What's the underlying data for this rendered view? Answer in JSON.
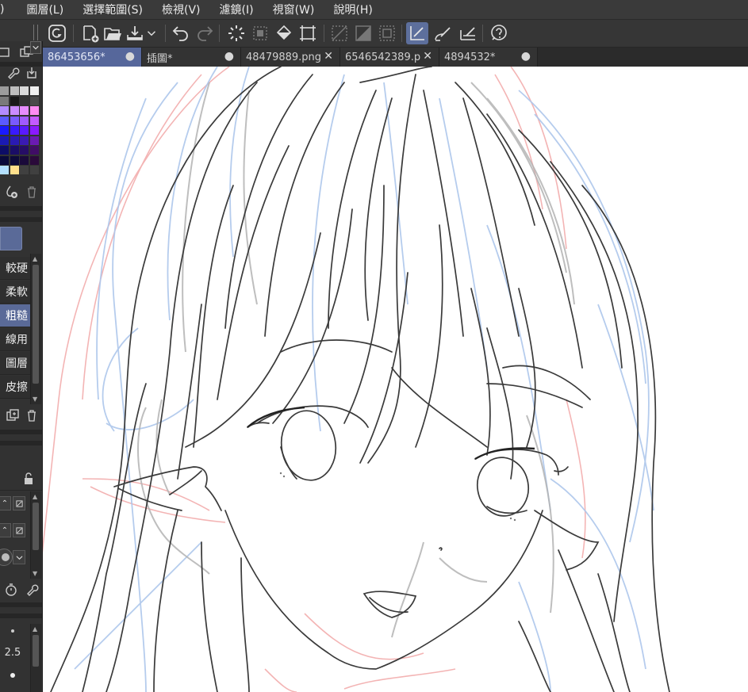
{
  "menu": {
    "items": [
      ")",
      "圖層(L)",
      "選擇範圍(S)",
      "檢視(V)",
      "濾鏡(I)",
      "視窗(W)",
      "說明(H)"
    ]
  },
  "commandbar": {
    "icons": [
      "app-logo-icon",
      "new-document-icon",
      "open-folder-icon",
      "export-icon",
      "export-dropdown-icon",
      "undo-icon",
      "redo-icon",
      "clear-selection-icon",
      "transform-selection-icon",
      "fill-icon",
      "crop-icon",
      "ruler-grid-icon",
      "perspective-icon",
      "frame-icon",
      "snap-to-ruler-icon",
      "snap-to-special-ruler-icon",
      "snap-to-grid-icon",
      "help-icon"
    ]
  },
  "tabs": [
    {
      "label": "86453656*",
      "control": "●",
      "active": true
    },
    {
      "label": "插圖*",
      "control": "●",
      "active": false
    },
    {
      "label": "48479889.png",
      "control": "✕",
      "active": false
    },
    {
      "label": "6546542389.p",
      "control": "✕",
      "active": false
    },
    {
      "label": "4894532*",
      "control": "●",
      "active": false
    }
  ],
  "palette": {
    "colors": [
      [
        "#9c9c9c",
        "#bfbfbf",
        "#dadada",
        "#f0f0f0"
      ],
      [
        "#7a7a7a",
        "#1a1a1a",
        "#333333",
        "#4a4a4a"
      ],
      [
        "#b38cff",
        "#cc8cff",
        "#e68cff",
        "#ff8cf2"
      ],
      [
        "#5a5aff",
        "#7a5aff",
        "#a05aff",
        "#c45aff"
      ],
      [
        "#1a1aff",
        "#3a1aff",
        "#5a1aff",
        "#8a1aff"
      ],
      [
        "#1a1ab3",
        "#2a1ab3",
        "#3a1ab3",
        "#6a1ab3"
      ],
      [
        "#0d0d66",
        "#1a0d66",
        "#260d66",
        "#400d66"
      ],
      [
        "#0a0a3a",
        "#0d0a3a",
        "#1a0a3a",
        "#2a0a3a"
      ],
      [
        "#b3e0ff",
        "#ffe08c",
        "#404040",
        "#404040"
      ]
    ]
  },
  "brushes": {
    "items": [
      "較硬",
      "柔軟",
      "粗糙",
      "線用",
      "圖層",
      "皮擦"
    ],
    "selected_index": 2
  },
  "properties": {
    "value": "2.5"
  }
}
